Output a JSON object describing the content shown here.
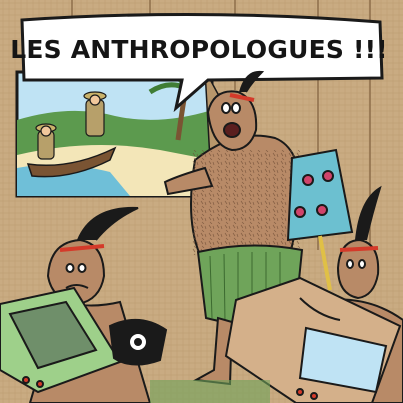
{
  "comic": {
    "speech_bubble_text": "LES ANTHROPOLOGUES !!!"
  },
  "colors": {
    "wall": "#c9ab82",
    "sky": "#bfe3f4",
    "sea": "#6fbfd8",
    "sand": "#f3e6b8",
    "skin": "#b88a67",
    "grass_skirt": "#6fa45a",
    "lampshade": "#6cc0d0",
    "tv_green": "#9ed08a",
    "box_tan": "#d4b08a",
    "outline": "#1a1a1a"
  }
}
